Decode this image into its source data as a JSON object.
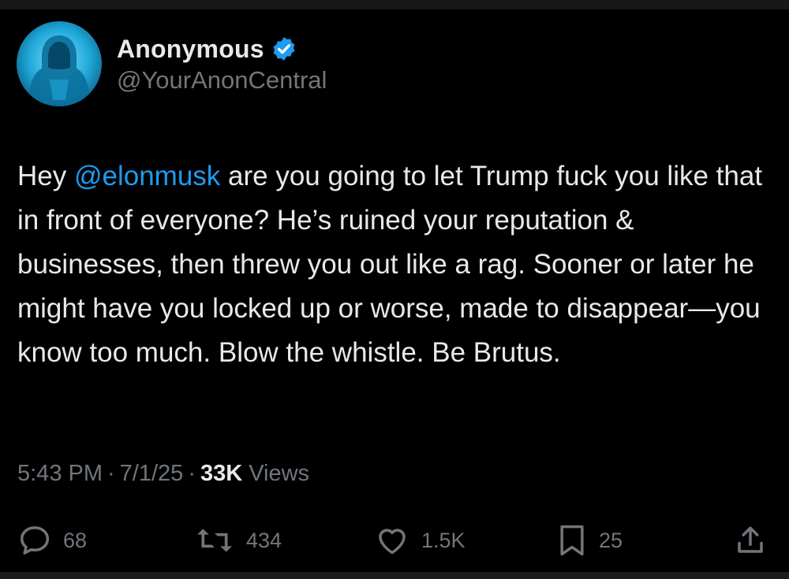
{
  "author": {
    "display_name": "Anonymous",
    "handle": "@YourAnonCentral",
    "verified": true,
    "avatar_icon": "hooded-figure-avatar"
  },
  "tweet": {
    "text_before_mention": "Hey ",
    "mention": "@elonmusk",
    "text_after_mention": " are you going to let Trump fuck you like that in front of everyone? He’s ruined your reputation & businesses, then threw you out like a rag. Sooner or later he might have you locked up or worse, made to disappear—you know too much. Blow the whistle. Be Brutus."
  },
  "meta": {
    "time": "5:43 PM",
    "separator": "·",
    "date": "7/1/25",
    "views_count": "33K",
    "views_label": "Views"
  },
  "actions": {
    "replies": "68",
    "reposts": "434",
    "likes": "1.5K",
    "bookmarks": "25"
  },
  "colors": {
    "background": "#000000",
    "text": "#e7e9ea",
    "secondary": "#71767b",
    "accent": "#1d9bf0"
  }
}
